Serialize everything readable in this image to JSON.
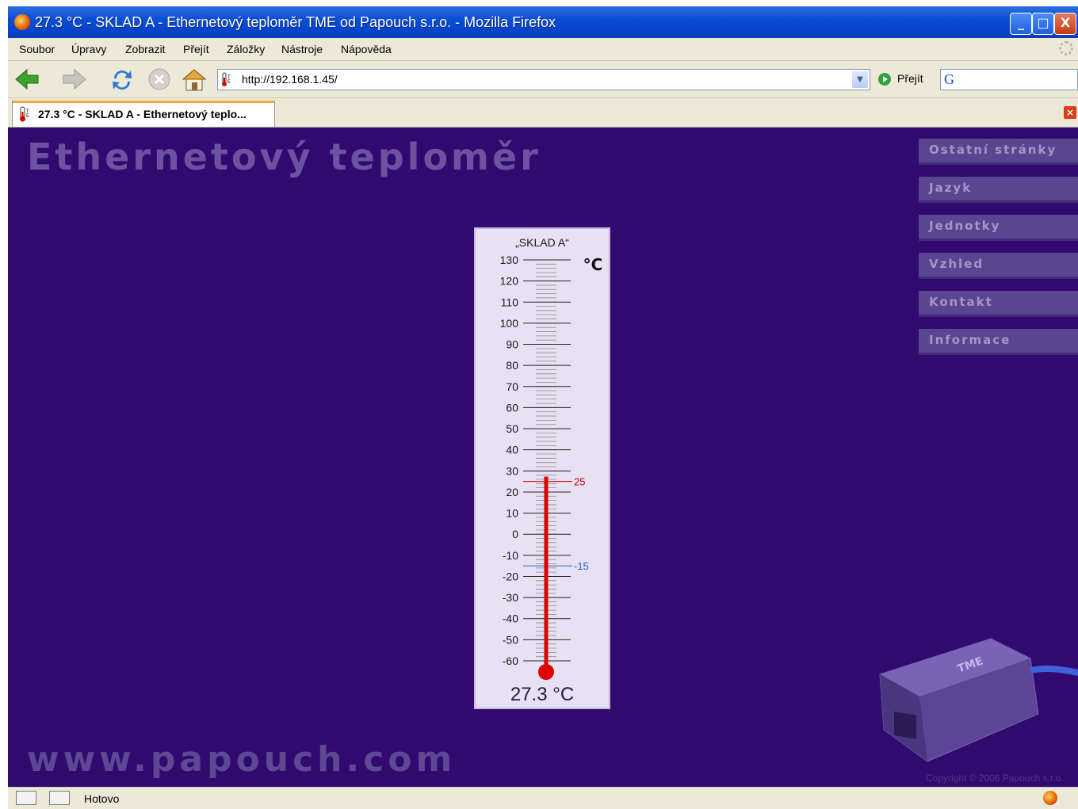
{
  "window": {
    "title": "27.3 °C - SKLAD A - Ethernetový teploměr TME od Papouch s.r.o. - Mozilla Firefox",
    "controls": {
      "minimize": "_",
      "maximize": "□",
      "close": "X"
    }
  },
  "menu": {
    "items": [
      "Soubor",
      "Úpravy",
      "Zobrazit",
      "Přejít",
      "Záložky",
      "Nástroje",
      "Nápověda"
    ]
  },
  "navbar": {
    "url": "http://192.168.1.45/",
    "go_label": "Přejít",
    "search_logo": "G"
  },
  "tab": {
    "title": "27.3 °C - SKLAD A - Ethernetový teplo...",
    "close": "×"
  },
  "page": {
    "heading": "Ethernetový teploměr",
    "site_url": "www.papouch.com",
    "copyright": "Copyright © 2006 Papouch s.r.o.",
    "device_label": "TME"
  },
  "sidemenu": {
    "items": [
      "Ostatní stránky",
      "Jazyk",
      "Jednotky",
      "Vzhled",
      "Kontakt",
      "Informace"
    ]
  },
  "thermometer": {
    "name": "„SKLAD A“",
    "unit": "°C",
    "current_value": 27.3,
    "readout": "27.3 °C",
    "scale_min": -60,
    "scale_max": 130,
    "labels": [
      130,
      120,
      110,
      100,
      90,
      80,
      70,
      60,
      50,
      40,
      30,
      20,
      10,
      0,
      -10,
      -20,
      -30,
      -40,
      -50,
      -60
    ],
    "upper_limit": 25,
    "lower_limit": -15,
    "colors": {
      "mercury": "#e00000",
      "upper_limit": "#cc0000",
      "lower_limit": "#2a6ab5",
      "scale": "#222222"
    }
  },
  "status": {
    "text": "Hotovo"
  }
}
